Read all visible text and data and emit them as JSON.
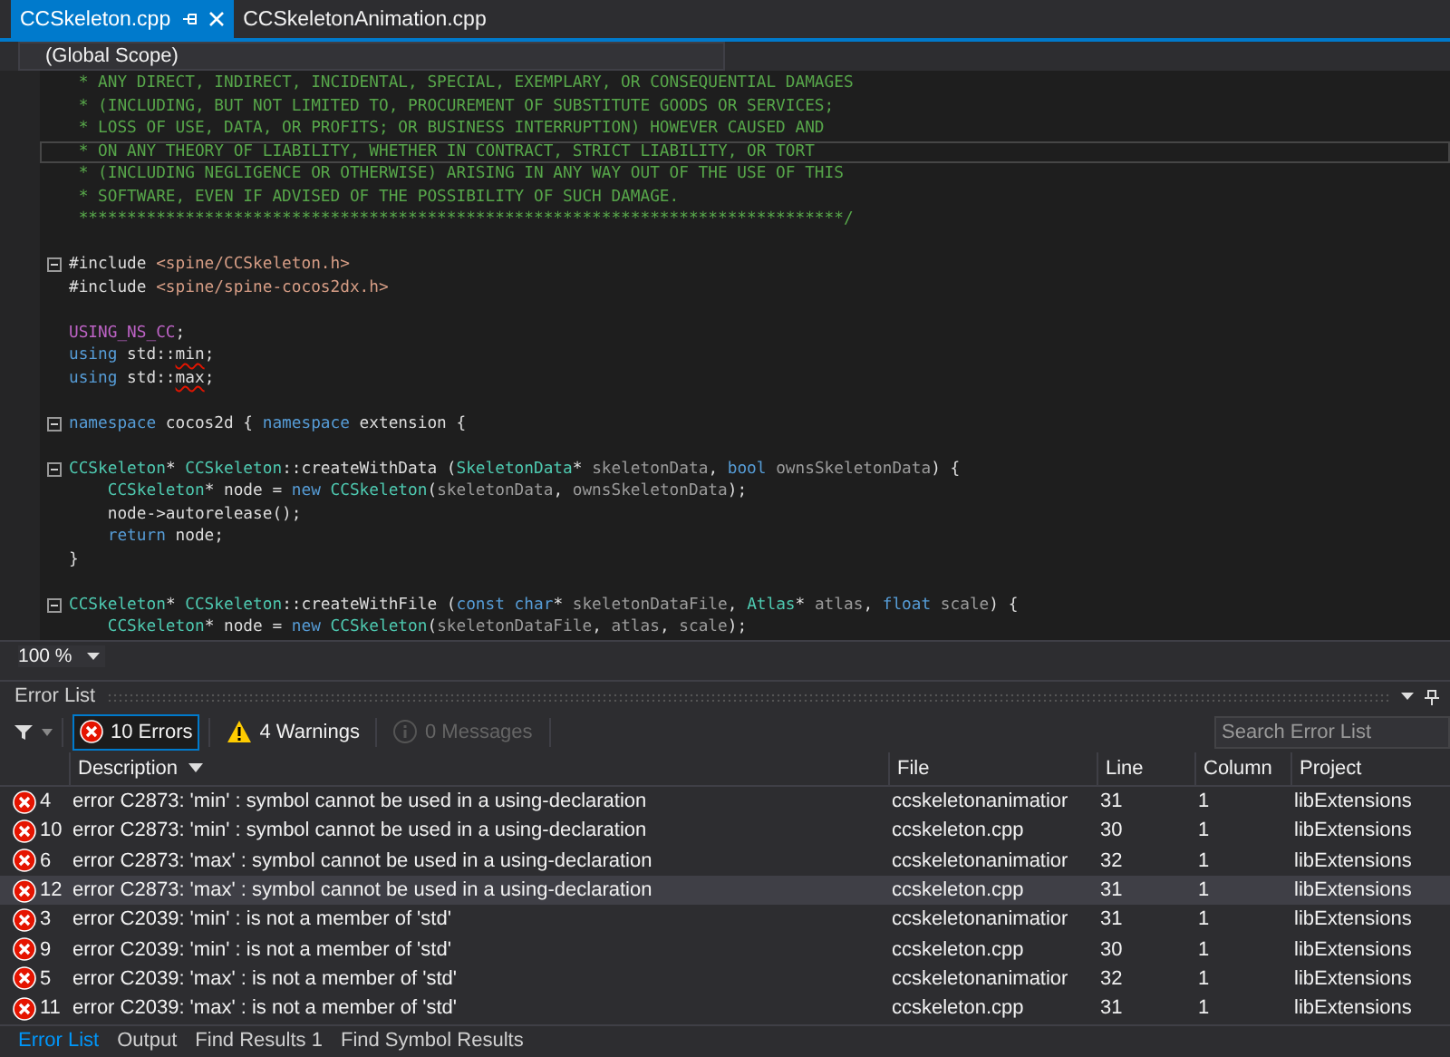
{
  "editor_tabs": [
    {
      "label": "CCSkeleton.cpp",
      "selected": true
    },
    {
      "label": "CCSkeletonAnimation.cpp",
      "selected": false
    }
  ],
  "scope": "(Global Scope)",
  "code": {
    "lines": [
      {
        "fold": false,
        "current": false,
        "tokens": [
          {
            "kind": "comment",
            "text": " * ANY DIRECT, INDIRECT, INCIDENTAL, SPECIAL, EXEMPLARY, OR CONSEQUENTIAL DAMAGES"
          }
        ]
      },
      {
        "fold": false,
        "current": false,
        "tokens": [
          {
            "kind": "comment",
            "text": " * (INCLUDING, BUT NOT LIMITED TO, PROCUREMENT OF SUBSTITUTE GOODS OR SERVICES;"
          }
        ]
      },
      {
        "fold": false,
        "current": false,
        "tokens": [
          {
            "kind": "comment",
            "text": " * LOSS OF USE, DATA, OR PROFITS; OR BUSINESS INTERRUPTION) HOWEVER CAUSED AND"
          }
        ]
      },
      {
        "fold": false,
        "current": true,
        "tokens": [
          {
            "kind": "comment",
            "text": " * ON ANY THEORY OF LIABILITY, WHETHER IN CONTRACT, STRICT LIABILITY, OR TORT"
          }
        ]
      },
      {
        "fold": false,
        "current": false,
        "tokens": [
          {
            "kind": "comment",
            "text": " * (INCLUDING NEGLIGENCE OR OTHERWISE) ARISING IN ANY WAY OUT OF THE USE OF THIS"
          }
        ]
      },
      {
        "fold": false,
        "current": false,
        "tokens": [
          {
            "kind": "comment",
            "text": " * SOFTWARE, EVEN IF ADVISED OF THE POSSIBILITY OF SUCH DAMAGE."
          }
        ]
      },
      {
        "fold": false,
        "current": false,
        "tokens": [
          {
            "kind": "comment",
            "text": " *******************************************************************************/"
          }
        ]
      },
      {
        "fold": false,
        "current": false
      },
      {
        "fold": true,
        "current": false,
        "tokens": [
          {
            "kind": "plain",
            "text": "#include "
          },
          {
            "kind": "string",
            "text": "<spine/CCSkeleton.h>"
          }
        ]
      },
      {
        "fold": false,
        "current": false,
        "tokens": [
          {
            "kind": "plain",
            "text": "#include "
          },
          {
            "kind": "string",
            "text": "<spine/spine-cocos2dx.h>"
          }
        ]
      },
      {
        "fold": false,
        "current": false
      },
      {
        "fold": false,
        "current": false,
        "tokens": [
          {
            "kind": "macro",
            "text": "USING_NS_CC"
          },
          {
            "kind": "plain",
            "text": ";"
          }
        ]
      },
      {
        "fold": false,
        "current": false,
        "tokens": [
          {
            "kind": "keyword",
            "text": "using"
          },
          {
            "kind": "plain",
            "text": " std::"
          },
          {
            "kind": "error",
            "text": "min"
          },
          {
            "kind": "plain",
            "text": ";"
          }
        ]
      },
      {
        "fold": false,
        "current": false,
        "tokens": [
          {
            "kind": "keyword",
            "text": "using"
          },
          {
            "kind": "plain",
            "text": " std::"
          },
          {
            "kind": "error",
            "text": "max"
          },
          {
            "kind": "plain",
            "text": ";"
          }
        ]
      },
      {
        "fold": false,
        "current": false
      },
      {
        "fold": true,
        "current": false,
        "tokens": [
          {
            "kind": "keyword",
            "text": "namespace"
          },
          {
            "kind": "plain",
            "text": " cocos2d { "
          },
          {
            "kind": "keyword",
            "text": "namespace"
          },
          {
            "kind": "plain",
            "text": " extension {"
          }
        ]
      },
      {
        "fold": false,
        "current": false
      },
      {
        "fold": true,
        "current": false,
        "tokens": [
          {
            "kind": "type",
            "text": "CCSkeleton"
          },
          {
            "kind": "plain",
            "text": "* "
          },
          {
            "kind": "type",
            "text": "CCSkeleton"
          },
          {
            "kind": "plain",
            "text": "::createWithData ("
          },
          {
            "kind": "type",
            "text": "SkeletonData"
          },
          {
            "kind": "plain",
            "text": "* "
          },
          {
            "kind": "param",
            "text": "skeletonData"
          },
          {
            "kind": "plain",
            "text": ", "
          },
          {
            "kind": "keyword",
            "text": "bool"
          },
          {
            "kind": "param",
            "text": " ownsSkeletonData"
          },
          {
            "kind": "plain",
            "text": ") {"
          }
        ]
      },
      {
        "fold": false,
        "current": false,
        "tokens": [
          {
            "kind": "type",
            "text": "    CCSkeleton"
          },
          {
            "kind": "plain",
            "text": "* node = "
          },
          {
            "kind": "keyword",
            "text": "new "
          },
          {
            "kind": "type",
            "text": "CCSkeleton"
          },
          {
            "kind": "plain",
            "text": "("
          },
          {
            "kind": "param",
            "text": "skeletonData"
          },
          {
            "kind": "plain",
            "text": ", "
          },
          {
            "kind": "param",
            "text": "ownsSkeletonData"
          },
          {
            "kind": "plain",
            "text": ");"
          }
        ]
      },
      {
        "fold": false,
        "current": false,
        "tokens": [
          {
            "kind": "plain",
            "text": "    node->autorelease();"
          }
        ]
      },
      {
        "fold": false,
        "current": false,
        "tokens": [
          {
            "kind": "keyword",
            "text": "    return"
          },
          {
            "kind": "plain",
            "text": " node;"
          }
        ]
      },
      {
        "fold": false,
        "current": false,
        "tokens": [
          {
            "kind": "plain",
            "text": "}"
          }
        ]
      },
      {
        "fold": false,
        "current": false
      },
      {
        "fold": true,
        "current": false,
        "tokens": [
          {
            "kind": "type",
            "text": "CCSkeleton"
          },
          {
            "kind": "plain",
            "text": "* "
          },
          {
            "kind": "type",
            "text": "CCSkeleton"
          },
          {
            "kind": "plain",
            "text": "::createWithFile ("
          },
          {
            "kind": "keyword",
            "text": "const char"
          },
          {
            "kind": "plain",
            "text": "* "
          },
          {
            "kind": "param",
            "text": "skeletonDataFile"
          },
          {
            "kind": "plain",
            "text": ", "
          },
          {
            "kind": "type",
            "text": "Atlas"
          },
          {
            "kind": "plain",
            "text": "* "
          },
          {
            "kind": "param",
            "text": "atlas"
          },
          {
            "kind": "plain",
            "text": ", "
          },
          {
            "kind": "keyword",
            "text": "float"
          },
          {
            "kind": "param",
            "text": " scale"
          },
          {
            "kind": "plain",
            "text": ") {"
          }
        ]
      },
      {
        "fold": false,
        "current": false,
        "tokens": [
          {
            "kind": "type",
            "text": "    CCSkeleton"
          },
          {
            "kind": "plain",
            "text": "* node = "
          },
          {
            "kind": "keyword",
            "text": "new "
          },
          {
            "kind": "type",
            "text": "CCSkeleton"
          },
          {
            "kind": "plain",
            "text": "("
          },
          {
            "kind": "param",
            "text": "skeletonDataFile"
          },
          {
            "kind": "plain",
            "text": ", "
          },
          {
            "kind": "param",
            "text": "atlas"
          },
          {
            "kind": "plain",
            "text": ", "
          },
          {
            "kind": "param",
            "text": "scale"
          },
          {
            "kind": "plain",
            "text": ");"
          }
        ]
      }
    ]
  },
  "zoom": "100 %",
  "error_list": {
    "title": "Error List",
    "filters": [
      {
        "kind": "error",
        "label": "10 Errors",
        "selected": true,
        "disabled": false
      },
      {
        "kind": "warning",
        "label": "4 Warnings",
        "selected": false,
        "disabled": false
      },
      {
        "kind": "info",
        "label": "0 Messages",
        "selected": false,
        "disabled": true
      }
    ],
    "search": {
      "placeholder": "Search Error List"
    },
    "columns": [
      {
        "label": "Description",
        "sorted": true
      },
      {
        "label": "File",
        "sorted": false
      },
      {
        "label": "Line",
        "sorted": false
      },
      {
        "label": "Column",
        "sorted": false
      },
      {
        "label": "Project",
        "sorted": false
      }
    ],
    "rows": [
      {
        "code": "4",
        "description": "error C2873: 'min' : symbol cannot be used in a using-declaration",
        "file": "ccskeletonanimatior",
        "line": "31",
        "column": "1",
        "project": "libExtensions",
        "selected": false
      },
      {
        "code": "10",
        "description": "error C2873: 'min' : symbol cannot be used in a using-declaration",
        "file": "ccskeleton.cpp",
        "line": "30",
        "column": "1",
        "project": "libExtensions",
        "selected": false
      },
      {
        "code": "6",
        "description": "error C2873: 'max' : symbol cannot be used in a using-declaration",
        "file": "ccskeletonanimatior",
        "line": "32",
        "column": "1",
        "project": "libExtensions",
        "selected": false
      },
      {
        "code": "12",
        "description": "error C2873: 'max' : symbol cannot be used in a using-declaration",
        "file": "ccskeleton.cpp",
        "line": "31",
        "column": "1",
        "project": "libExtensions",
        "selected": true
      },
      {
        "code": "3",
        "description": "error C2039: 'min' : is not a member of 'std'",
        "file": "ccskeletonanimatior",
        "line": "31",
        "column": "1",
        "project": "libExtensions",
        "selected": false
      },
      {
        "code": "9",
        "description": "error C2039: 'min' : is not a member of 'std'",
        "file": "ccskeleton.cpp",
        "line": "30",
        "column": "1",
        "project": "libExtensions",
        "selected": false
      },
      {
        "code": "5",
        "description": "error C2039: 'max' : is not a member of 'std'",
        "file": "ccskeletonanimatior",
        "line": "32",
        "column": "1",
        "project": "libExtensions",
        "selected": false
      },
      {
        "code": "11",
        "description": "error C2039: 'max' : is not a member of 'std'",
        "file": "ccskeleton.cpp",
        "line": "31",
        "column": "1",
        "project": "libExtensions",
        "selected": false
      }
    ]
  },
  "bottom_tabs": [
    {
      "label": "Error List",
      "selected": true
    },
    {
      "label": "Output",
      "selected": false
    },
    {
      "label": "Find Results 1",
      "selected": false
    },
    {
      "label": "Find Symbol Results",
      "selected": false
    }
  ]
}
